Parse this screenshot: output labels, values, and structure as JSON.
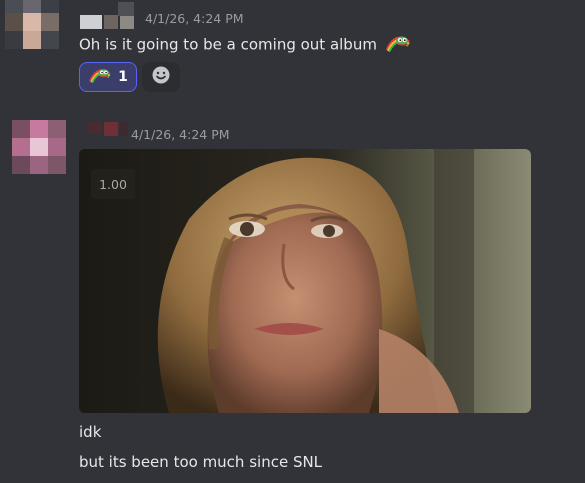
{
  "messages": [
    {
      "timestamp": "4/1/26, 4:24 PM",
      "lines": [
        "Oh is it going to be a coming out album"
      ],
      "inline_emoji": "pepe-rainbow-emoji",
      "reactions": [
        {
          "emoji": "pepe-rainbow-emoji",
          "count": "1",
          "selected": true
        }
      ],
      "add_reaction_icon": "smiley-add-reaction-icon"
    },
    {
      "timestamp": "4/1/26, 4:24 PM",
      "attachment": {
        "type": "video-gif",
        "description": "close-up of a tearful woman with wavy blonde hair",
        "speed_badge": "1.00"
      },
      "lines": [
        "idk",
        "but its been too much since SNL"
      ]
    }
  ],
  "colors": {
    "background": "#313338",
    "text": "#e6e7ea",
    "timestamp": "#9b9ca3",
    "reaction_border": "#5865f2",
    "reaction_bg": "#3b3e6b"
  }
}
